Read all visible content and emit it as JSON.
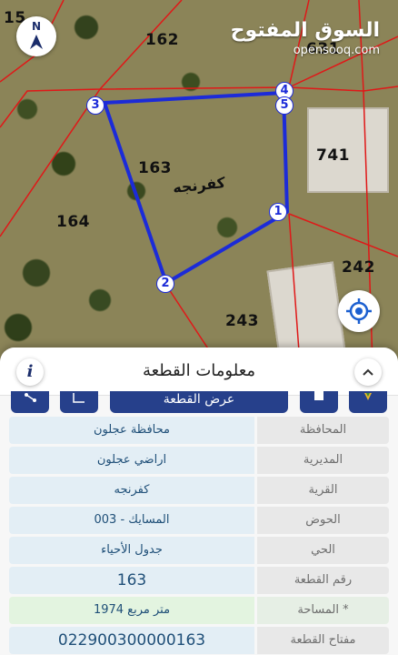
{
  "map": {
    "parcel_labels": [
      "162",
      "163",
      "164",
      "741",
      "242",
      "243",
      "631",
      "15"
    ],
    "village_label": "كفرنجه",
    "vertices": [
      "1",
      "2",
      "3",
      "4",
      "5"
    ],
    "compass_letter": "N",
    "compass_icon": "north-arrow-icon",
    "locate_icon": "crosshair-icon",
    "logo": {
      "arabic": "السوق المفتوح",
      "latin": "opensooq.com"
    },
    "colors": {
      "selected_parcel": "#1c2bd8",
      "parcel_border": "#e01818"
    }
  },
  "sheet": {
    "title": "معلومات القطعة",
    "info_icon": "i",
    "collapse_icon": "chevron-up-icon",
    "toolbar": {
      "view_button_label": "عرض القطعة",
      "icons": [
        "share-icon",
        "measure-icon",
        "download-icon",
        "bookmark-icon",
        "marker-icon"
      ]
    },
    "rows": [
      {
        "label": "المحافظة",
        "value": "محافظة عجلون"
      },
      {
        "label": "المديرية",
        "value": "اراضي عجلون"
      },
      {
        "label": "القرية",
        "value": "كفرنجه"
      },
      {
        "label": "الحوض",
        "value": "المسايك - 003"
      },
      {
        "label": "الحي",
        "value": "جدول الأحياء"
      },
      {
        "label": "رقم القطعة",
        "value": "163"
      },
      {
        "label": "المساحة *",
        "value": "1974  متر مربع"
      },
      {
        "label": "مفتاح القطعة",
        "value": "022900300000163"
      }
    ]
  }
}
